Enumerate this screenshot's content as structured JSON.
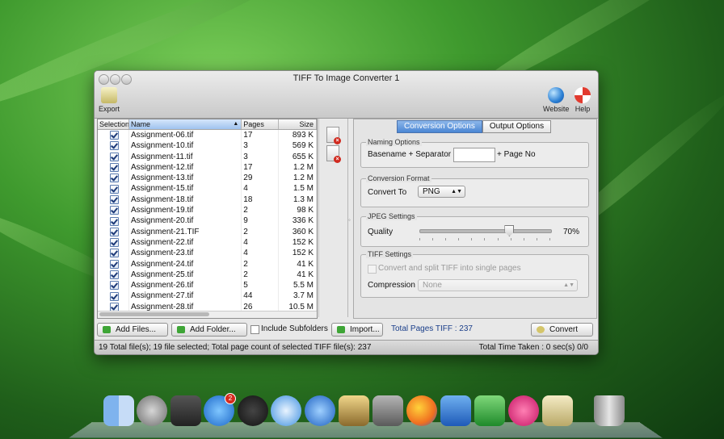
{
  "window": {
    "title": "TIFF To Image Converter 1"
  },
  "toolbar": {
    "export_label": "Export",
    "website_label": "Website",
    "help_label": "Help"
  },
  "list": {
    "columns": {
      "selection": "Selection",
      "name": "Name",
      "pages": "Pages",
      "size": "Size"
    },
    "rows": [
      {
        "name": "Assignment-06.tif",
        "pages": "17",
        "size": "893 K"
      },
      {
        "name": "Assignment-10.tif",
        "pages": "3",
        "size": "569 K"
      },
      {
        "name": "Assignment-11.tif",
        "pages": "3",
        "size": "655 K"
      },
      {
        "name": "Assignment-12.tif",
        "pages": "17",
        "size": "1.2 M"
      },
      {
        "name": "Assignment-13.tif",
        "pages": "29",
        "size": "1.2 M"
      },
      {
        "name": "Assignment-15.tif",
        "pages": "4",
        "size": "1.5 M"
      },
      {
        "name": "Assignment-18.tif",
        "pages": "18",
        "size": "1.3 M"
      },
      {
        "name": "Assignment-19.tif",
        "pages": "2",
        "size": "98 K"
      },
      {
        "name": "Assignment-20.tif",
        "pages": "9",
        "size": "336 K"
      },
      {
        "name": "Assignment-21.TIF",
        "pages": "2",
        "size": "360 K"
      },
      {
        "name": "Assignment-22.tif",
        "pages": "4",
        "size": "152 K"
      },
      {
        "name": "Assignment-23.tif",
        "pages": "4",
        "size": "152 K"
      },
      {
        "name": "Assignment-24.tif",
        "pages": "2",
        "size": "41 K"
      },
      {
        "name": "Assignment-25.tif",
        "pages": "2",
        "size": "41 K"
      },
      {
        "name": "Assignment-26.tif",
        "pages": "5",
        "size": "5.5 M"
      },
      {
        "name": "Assignment-27.tif",
        "pages": "44",
        "size": "3.7 M"
      },
      {
        "name": "Assignment-28.tif",
        "pages": "26",
        "size": "10.5 M"
      }
    ]
  },
  "tabs": {
    "conversion": "Conversion Options",
    "output": "Output Options"
  },
  "naming": {
    "title": "Naming Options",
    "basename_label": "Basename + Separator",
    "basename_value": "",
    "suffix_label": "+ Page No"
  },
  "format": {
    "title": "Conversion Format",
    "convert_label": "Convert To",
    "value": "PNG"
  },
  "jpeg": {
    "title": "JPEG Settings",
    "quality_label": "Quality",
    "quality_value": "70%",
    "quality_fraction": 0.7
  },
  "tiff": {
    "title": "TIFF Settings",
    "split_label": "Convert and split TIFF into single pages",
    "compression_label": "Compression",
    "compression_value": "None"
  },
  "bottom": {
    "add_files": "Add Files...",
    "add_folder": "Add Folder...",
    "include_subfolders": "Include Subfolders",
    "import": "Import...",
    "total_pages": "Total Pages TIFF : 237",
    "convert": "Convert"
  },
  "status": {
    "left": "19 Total file(s); 19 file selected; Total page count of selected TIFF file(s): 237",
    "right": "Total Time Taken : 0 sec(s) 0/0"
  },
  "dock": {
    "app_store_badge": "2"
  },
  "colors": {
    "accent": "#4a86d4",
    "total_pages_text": "#1b3f8a",
    "remove_red": "#d12a1f"
  }
}
